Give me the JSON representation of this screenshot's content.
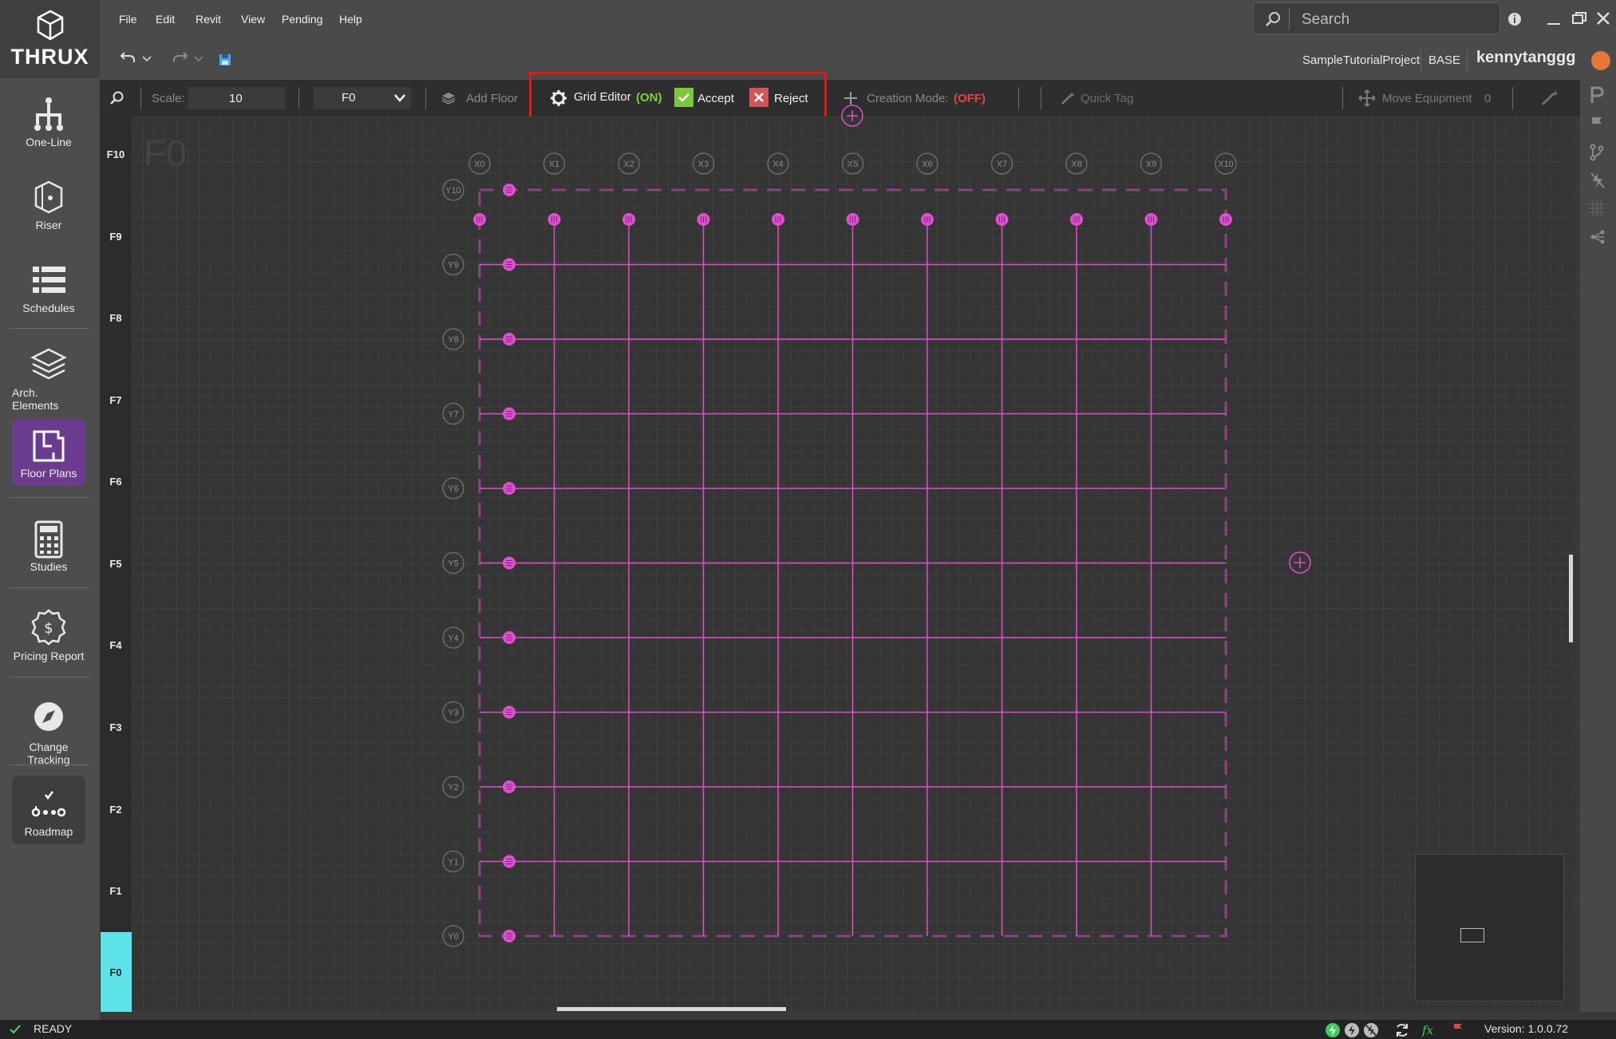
{
  "app": {
    "brand": "THRUX"
  },
  "menu": [
    "File",
    "Edit",
    "Revit",
    "View",
    "Pending",
    "Help"
  ],
  "search": {
    "placeholder": "Search"
  },
  "header": {
    "project": "SampleTutorialProject",
    "branch": "BASE",
    "user": "kennytanggg"
  },
  "sidebar": {
    "items": [
      {
        "label": "One-Line",
        "icon": "one-line-icon"
      },
      {
        "label": "Riser",
        "icon": "riser-icon"
      },
      {
        "label": "Schedules",
        "icon": "schedules-icon"
      },
      {
        "label": "Arch. Elements",
        "icon": "layers-icon"
      },
      {
        "label": "Floor Plans",
        "icon": "floor-plan-icon",
        "active": true
      },
      {
        "label": "Studies",
        "icon": "calculator-icon"
      },
      {
        "label": "Pricing Report",
        "icon": "pricing-badge-icon"
      },
      {
        "label": "Change Tracking",
        "icon": "compass-icon"
      },
      {
        "label": "Roadmap",
        "icon": "roadmap-icon"
      }
    ]
  },
  "toolbar": {
    "scale_label": "Scale:",
    "scale_value": "10",
    "floor_value": "F0",
    "add_floor": "Add Floor",
    "grid_editor": "Grid Editor",
    "grid_editor_state": "(ON)",
    "accept": "Accept",
    "reject": "Reject",
    "creation_mode": "Creation Mode:",
    "creation_mode_state": "(OFF)",
    "quick_tag": "Quick Tag",
    "move_equipment": "Move Equipment",
    "move_equipment_count": "0"
  },
  "floors": [
    "F10",
    "F9",
    "F8",
    "F7",
    "F6",
    "F5",
    "F4",
    "F3",
    "F2",
    "F1",
    "F0"
  ],
  "canvas": {
    "title": "F0",
    "x_labels": [
      "X0",
      "X1",
      "X2",
      "X3",
      "X4",
      "X5",
      "X6",
      "X7",
      "X8",
      "X9",
      "X10"
    ],
    "y_labels": [
      "Y10",
      "Y9",
      "Y8",
      "Y7",
      "Y6",
      "Y5",
      "Y4",
      "Y3",
      "Y2",
      "Y1",
      "Y0"
    ]
  },
  "status": {
    "text": "READY",
    "version": "Version: 1.0.0.72"
  },
  "colors": {
    "accent": "#6a3b8f",
    "grid": "#e04fd2",
    "on": "#7cd62d",
    "off": "#e04545",
    "floor_active": "#5de3e8"
  }
}
